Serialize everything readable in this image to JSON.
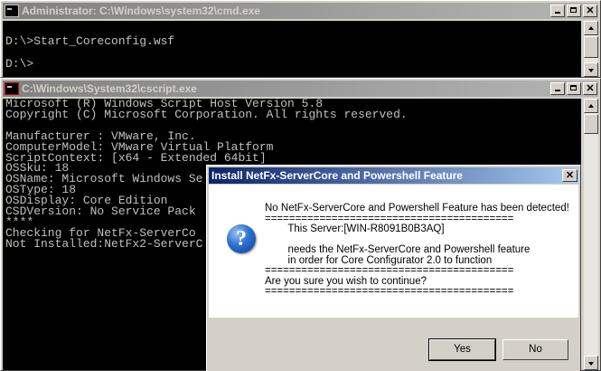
{
  "cmd_window": {
    "title": "Administrator: C:\\Windows\\system32\\cmd.exe",
    "lines": [
      "",
      "D:\\>Start_Coreconfig.wsf",
      "",
      "D:\\>"
    ]
  },
  "cscript_window": {
    "title": "C:\\Windows\\System32\\cscript.exe",
    "lines": [
      "Microsoft (R) Windows Script Host Version 5.8",
      "Copyright (C) Microsoft Corporation. All rights reserved.",
      "",
      "Manufacturer : VMware, Inc.",
      "ComputerModel: VMware Virtual Platform",
      "ScriptContext: [x64 - Extended 64bit]",
      "OSSku: 18",
      "OSName: Microsoft Windows Se",
      "OSType: 18",
      "OSDisplay: Core Edition",
      "CSDVersion: No Service Pack",
      "****",
      "Checking for NetFx-ServerCo",
      "Not Installed:NetFx2-ServerC"
    ]
  },
  "dialog": {
    "title": "Install NetFx-ServerCore and Powershell Feature",
    "message": "No NetFx-ServerCore and Powershell Feature has been detected!\n=========================================\n        This Server:[WIN-R8091B0B3AQ]\n\n        needs the NetFx-ServerCore and Powershell feature\n        in order for Core Configurator 2.0 to function\n=========================================\nAre you sure you wish to continue?\n=========================================",
    "yes_label": "Yes",
    "no_label": "No"
  },
  "icons": {
    "question": "?",
    "close": "✕"
  }
}
